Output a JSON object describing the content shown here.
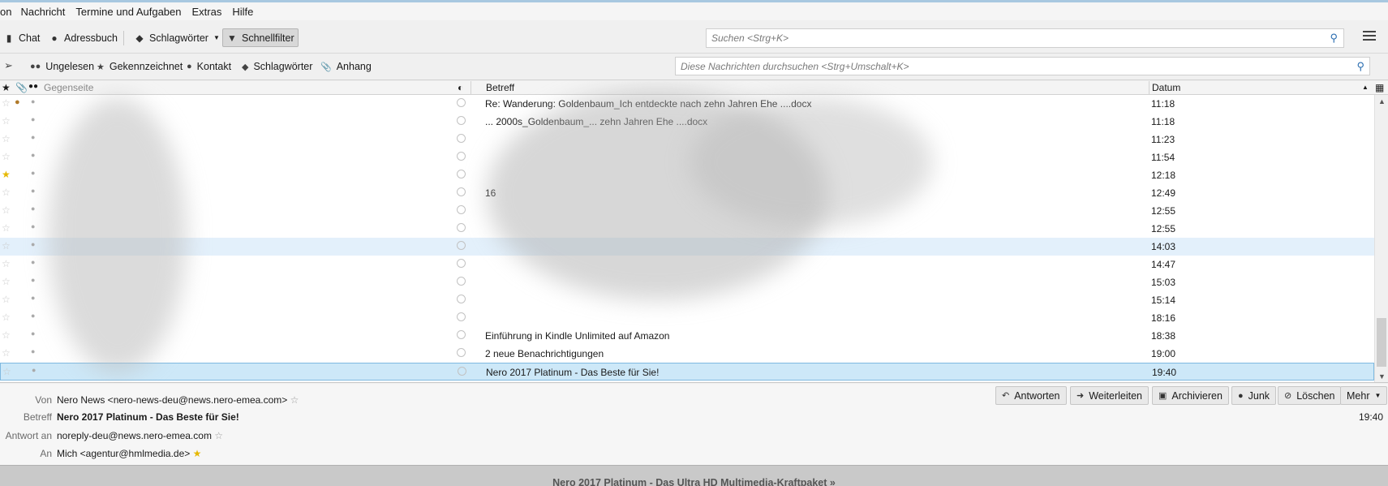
{
  "menu": [
    "on",
    "Nachricht",
    "Termine und Aufgaben",
    "Extras",
    "Hilfe"
  ],
  "toolbar": {
    "chat": "Chat",
    "addressbook": "Adressbuch",
    "tags": "Schlagwörter",
    "quickfilter": "Schnellfilter",
    "search_placeholder": "Suchen <Strg+K>"
  },
  "quickfilter": {
    "unread": "Ungelesen",
    "starred": "Gekennzeichnet",
    "contact": "Kontakt",
    "tags": "Schlagwörter",
    "attachment": "Anhang",
    "search_placeholder": "Diese Nachrichten durchsuchen <Strg+Umschalt+K>"
  },
  "columns": {
    "correspondent": "Gegenseite",
    "subject": "Betreff",
    "date": "Datum"
  },
  "messages": [
    {
      "subject": "Re: Wanderung: Goldenbaum_Ich entdeckte nach zehn Jahren Ehe ....docx",
      "date": "11:18",
      "starred": false,
      "attach": true
    },
    {
      "subject": "... 2000s_Goldenbaum_... zehn Jahren Ehe ....docx",
      "date": "11:18",
      "starred": false,
      "attach": false
    },
    {
      "subject": "",
      "date": "11:23",
      "starred": false,
      "attach": false
    },
    {
      "subject": "",
      "date": "11:54",
      "starred": false,
      "attach": false
    },
    {
      "subject": "",
      "date": "12:18",
      "starred": true,
      "attach": false
    },
    {
      "subject": "16",
      "date": "12:49",
      "starred": false,
      "attach": false
    },
    {
      "subject": "",
      "date": "12:55",
      "starred": false,
      "attach": false
    },
    {
      "subject": "",
      "date": "12:55",
      "starred": false,
      "attach": false
    },
    {
      "subject": "",
      "date": "14:03",
      "starred": false,
      "attach": false
    },
    {
      "subject": "",
      "date": "14:47",
      "starred": false,
      "attach": false
    },
    {
      "subject": "",
      "date": "15:03",
      "starred": false,
      "attach": false
    },
    {
      "subject": "",
      "date": "15:14",
      "starred": false,
      "attach": false
    },
    {
      "subject": "",
      "date": "18:16",
      "starred": false,
      "attach": false
    },
    {
      "subject": "Einführung in Kindle Unlimited auf Amazon",
      "date": "18:38",
      "starred": false,
      "attach": false
    },
    {
      "subject": "2 neue Benachrichtigungen",
      "date": "19:00",
      "starred": false,
      "attach": false
    },
    {
      "subject": "Nero 2017 Platinum - Das Beste für Sie!",
      "date": "19:40",
      "starred": false,
      "attach": false
    }
  ],
  "header": {
    "from_label": "Von",
    "from": "Nero News <nero-news-deu@news.nero-emea.com>",
    "subject_label": "Betreff",
    "subject": "Nero 2017 Platinum - Das Beste für Sie!",
    "replyto_label": "Antwort an",
    "replyto": "noreply-deu@news.nero-emea.com",
    "to_label": "An",
    "to": "Mich <agentur@hmlmedia.de>",
    "date": "19:40",
    "reply": "Antworten",
    "forward": "Weiterleiten",
    "archive": "Archivieren",
    "junk": "Junk",
    "delete": "Löschen",
    "more": "Mehr"
  },
  "body": {
    "title": "Nero 2017 Platinum - Das Ultra HD Multimedia-Kraftpaket »"
  }
}
